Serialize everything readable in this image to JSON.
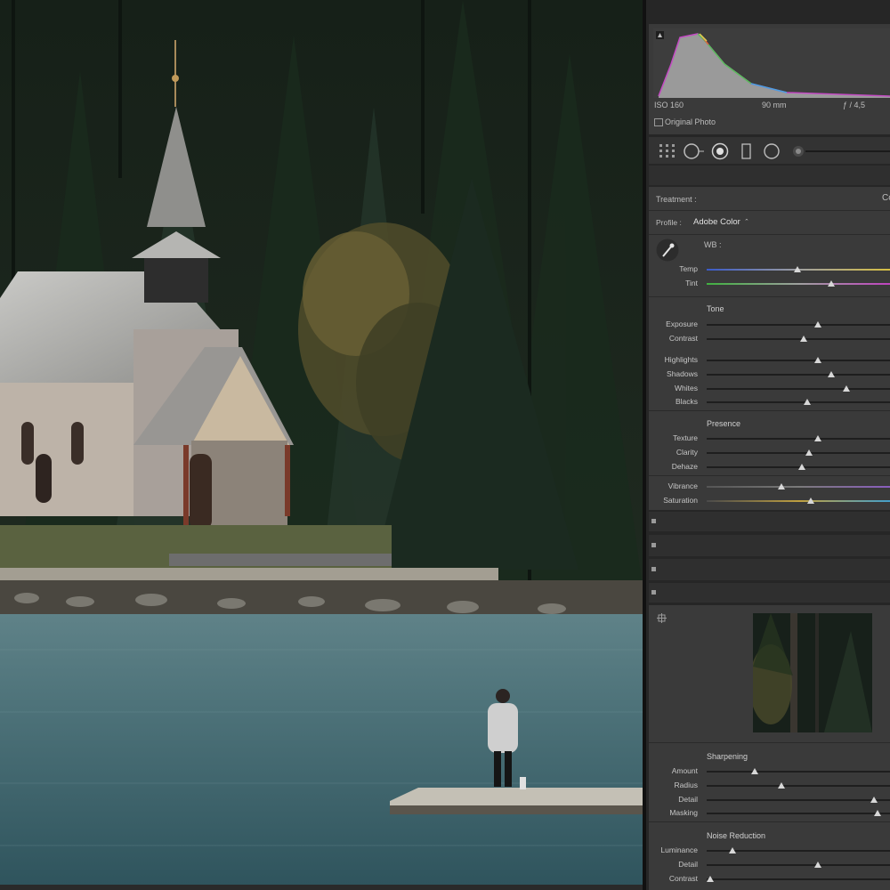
{
  "histogram": {
    "iso": "ISO 160",
    "focal": "90 mm",
    "aperture": "ƒ / 4,5",
    "original_photo_label": "Original Photo"
  },
  "tools": {
    "icons": [
      "grid-icon",
      "crop-icon",
      "spot-removal-icon",
      "graduated-filter-icon",
      "radial-filter-icon",
      "brush-toggle-icon"
    ]
  },
  "basic": {
    "treatment_label": "Treatment :",
    "treatment_value": "Co",
    "profile_label": "Profile :",
    "profile_value": "Adobe Color",
    "profile_arrow": "⌃",
    "wb_label": "WB :",
    "sliders_wb": [
      {
        "label": "Temp",
        "value": 0.49
      },
      {
        "label": "Tint",
        "value": 0.67
      }
    ],
    "tone_label": "Tone",
    "sliders_tone": [
      {
        "label": "Exposure",
        "value": 0.6
      },
      {
        "label": "Contrast",
        "value": 0.52
      }
    ],
    "sliders_tone2": [
      {
        "label": "Highlights",
        "value": 0.6
      },
      {
        "label": "Shadows",
        "value": 0.67
      },
      {
        "label": "Whites",
        "value": 0.75
      },
      {
        "label": "Blacks",
        "value": 0.54
      }
    ],
    "presence_label": "Presence",
    "sliders_presence": [
      {
        "label": "Texture",
        "value": 0.6
      },
      {
        "label": "Clarity",
        "value": 0.55
      },
      {
        "label": "Dehaze",
        "value": 0.51
      }
    ],
    "sliders_vibrance": [
      {
        "label": "Vibrance",
        "value": 0.4
      },
      {
        "label": "Saturation",
        "value": 0.56
      }
    ]
  },
  "detail": {
    "sharpening_label": "Sharpening",
    "sliders_sharpening": [
      {
        "label": "Amount",
        "value": 0.26
      },
      {
        "label": "Radius",
        "value": 0.4
      },
      {
        "label": "Detail",
        "value": 0.9
      },
      {
        "label": "Masking",
        "value": 0.92
      }
    ],
    "noise_label": "Noise Reduction",
    "sliders_noise": [
      {
        "label": "Luminance",
        "value": 0.14
      },
      {
        "label": "Detail",
        "value": 0.6
      },
      {
        "label": "Contrast",
        "value": 0.02
      }
    ]
  },
  "colors": {
    "panel_bg": "#3a3a3a",
    "header_bg": "#2f2f2f",
    "accent": "#d7d7d7"
  }
}
